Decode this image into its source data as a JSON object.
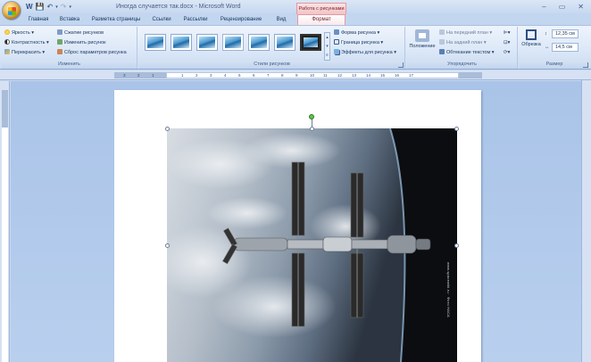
{
  "window": {
    "title": "Иногда случается так.docx - Microsoft Word",
    "context_title": "Работа с рисунками",
    "controls": [
      "–",
      "▭",
      "✕"
    ]
  },
  "qat": [
    "W",
    "💾",
    "↶",
    "▾",
    "↷",
    "▾"
  ],
  "tabs": [
    "Главная",
    "Вставка",
    "Разметка страницы",
    "Ссылки",
    "Рассылки",
    "Рецензирование",
    "Вид",
    "Формат"
  ],
  "ribbon": {
    "adjust": {
      "label": "Изменить",
      "brightness": "Яркость",
      "contrast": "Контрастность",
      "recolor": "Перекрасить",
      "compress": "Сжатие рисунков",
      "change": "Изменить рисунок",
      "reset": "Сброс параметров рисунка"
    },
    "styles": {
      "label": "Стили рисунков",
      "shape": "Форма рисунка",
      "border": "Граница рисунка",
      "effects": "Эффекты для рисунка"
    },
    "arrange": {
      "label": "Упорядочить",
      "position": "Положение",
      "front": "На передний план",
      "back": "На задний план",
      "wrap": "Обтекание текстом"
    },
    "size": {
      "label": "Размер",
      "crop": "Обрезка",
      "height": "12,35 см",
      "width": "14,5 см"
    }
  },
  "ruler_ticks": [
    "3",
    "2",
    "1",
    "1",
    "2",
    "3",
    "4",
    "5",
    "6",
    "7",
    "8",
    "9",
    "10",
    "11",
    "12",
    "13",
    "14",
    "15",
    "16",
    "17"
  ],
  "document": {
    "image_credit": "www.spacewiki.ru · Фото НАСА"
  },
  "colors": {
    "ribbon_bg": "#dbe7f7",
    "context_tab": "#f3c3c6",
    "workspace": "#b9cfee"
  }
}
